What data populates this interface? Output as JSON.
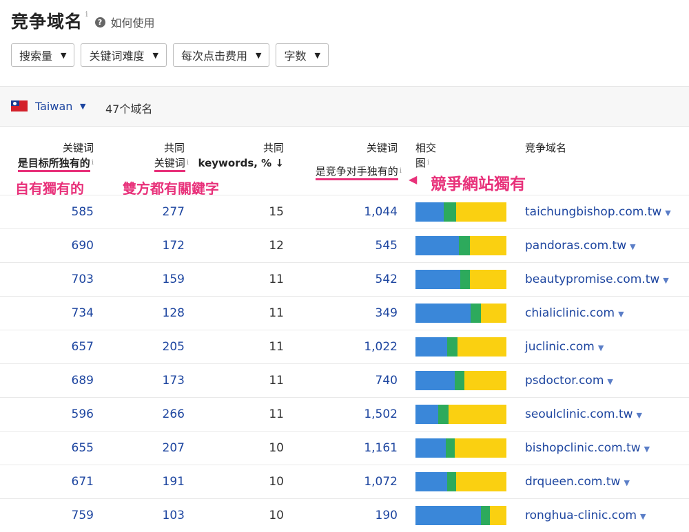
{
  "header": {
    "title": "竞争域名",
    "title_info": "i",
    "help_icon": "?",
    "help_label": "如何使用"
  },
  "filters": [
    {
      "label": "搜索量"
    },
    {
      "label": "关键词难度"
    },
    {
      "label": "每次点击费用"
    },
    {
      "label": "字数"
    }
  ],
  "caret": "▼",
  "country": {
    "name": "Taiwan",
    "domain_count": "47个域名",
    "flag_colors": {
      "field": "#d3202a",
      "canton": "#1a3b8f",
      "sun": "#ffffff"
    }
  },
  "columns": {
    "target_only_line1": "关键词",
    "target_only_line2": "是目标所独有的",
    "common_line1": "共同",
    "common_line2": "关键词",
    "common_pct_line1": "共同",
    "common_pct_line2": "keywords, % ↓",
    "competitor_only_line1": "关键词",
    "competitor_only_line2": "是竞争对手独有的",
    "intersection_line1": "相交",
    "intersection_line2": "图",
    "competitor_domain": "竞争域名",
    "info": "i"
  },
  "annotations": {
    "target_only": "自有獨有的",
    "common": "雙方都有關鍵字",
    "competitor_only": "競爭網站獨有",
    "arrow": "◀"
  },
  "colors": {
    "accent_link": "#1e46a0",
    "annotation_pink": "#e8317a",
    "bar_blue": "#3a87d9",
    "bar_green": "#2daa5c",
    "bar_yellow": "#fad011"
  },
  "rows": [
    {
      "target_only": "585",
      "common": "277",
      "common_pct": "15",
      "competitor_only": "1,044",
      "domain": "taichungbishop.com.tw",
      "bar": [
        0.31,
        0.14,
        0.55
      ]
    },
    {
      "target_only": "690",
      "common": "172",
      "common_pct": "12",
      "competitor_only": "545",
      "domain": "pandoras.com.tw",
      "bar": [
        0.48,
        0.12,
        0.4
      ]
    },
    {
      "target_only": "703",
      "common": "159",
      "common_pct": "11",
      "competitor_only": "542",
      "domain": "beautypromise.com.tw",
      "bar": [
        0.49,
        0.11,
        0.4
      ]
    },
    {
      "target_only": "734",
      "common": "128",
      "common_pct": "11",
      "competitor_only": "349",
      "domain": "chialiclinic.com",
      "bar": [
        0.61,
        0.11,
        0.28
      ]
    },
    {
      "target_only": "657",
      "common": "205",
      "common_pct": "11",
      "competitor_only": "1,022",
      "domain": "juclinic.com",
      "bar": [
        0.35,
        0.11,
        0.54
      ]
    },
    {
      "target_only": "689",
      "common": "173",
      "common_pct": "11",
      "competitor_only": "740",
      "domain": "psdoctor.com",
      "bar": [
        0.43,
        0.11,
        0.46
      ]
    },
    {
      "target_only": "596",
      "common": "266",
      "common_pct": "11",
      "competitor_only": "1,502",
      "domain": "seoulclinic.com.tw",
      "bar": [
        0.25,
        0.11,
        0.64
      ]
    },
    {
      "target_only": "655",
      "common": "207",
      "common_pct": "10",
      "competitor_only": "1,161",
      "domain": "bishopclinic.com.tw",
      "bar": [
        0.33,
        0.1,
        0.57
      ]
    },
    {
      "target_only": "671",
      "common": "191",
      "common_pct": "10",
      "competitor_only": "1,072",
      "domain": "drqueen.com.tw",
      "bar": [
        0.35,
        0.1,
        0.55
      ]
    },
    {
      "target_only": "759",
      "common": "103",
      "common_pct": "10",
      "competitor_only": "190",
      "domain": "ronghua-clinic.com",
      "bar": [
        0.72,
        0.1,
        0.18
      ]
    }
  ]
}
